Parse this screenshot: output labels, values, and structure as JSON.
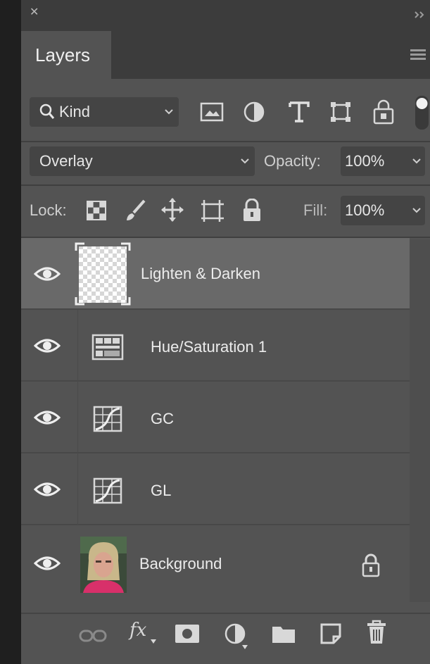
{
  "panel": {
    "tab_label": "Layers",
    "close_icon": "close-icon",
    "menu_icon": "panel-menu-icon"
  },
  "filter": {
    "kind_label": "Kind",
    "icons": [
      "image-filter-icon",
      "adjustment-filter-icon",
      "type-filter-icon",
      "shape-filter-icon",
      "smart-object-filter-icon",
      "filter-toggle-icon"
    ]
  },
  "blend": {
    "mode": "Overlay",
    "opacity_label": "Opacity:",
    "opacity_value": "100%"
  },
  "lock": {
    "label": "Lock:",
    "icons": [
      "lock-transparent-pixels-icon",
      "lock-image-pixels-icon",
      "lock-position-icon",
      "lock-artboard-icon",
      "lock-all-icon"
    ],
    "fill_label": "Fill:",
    "fill_value": "100%"
  },
  "layers": [
    {
      "name": "Lighten & Darken",
      "type": "pixel",
      "visible": true,
      "selected": true
    },
    {
      "name": "Hue/Saturation 1",
      "type": "adjustment",
      "visible": true,
      "selected": false
    },
    {
      "name": "GC",
      "type": "adjustment",
      "visible": true,
      "selected": false
    },
    {
      "name": "GL",
      "type": "adjustment",
      "visible": true,
      "selected": false
    },
    {
      "name": "Background",
      "type": "photo",
      "visible": true,
      "selected": false,
      "locked": true
    }
  ],
  "footer": {
    "fx_label": "fx",
    "icons": [
      "link-layers-icon",
      "fx-icon",
      "add-mask-icon",
      "new-adjustment-layer-icon",
      "new-group-icon",
      "new-layer-icon",
      "delete-layer-icon"
    ]
  },
  "colors": {
    "panel_bg": "#535353",
    "selected_row": "#696969",
    "chrome": "#3c3c3c"
  }
}
